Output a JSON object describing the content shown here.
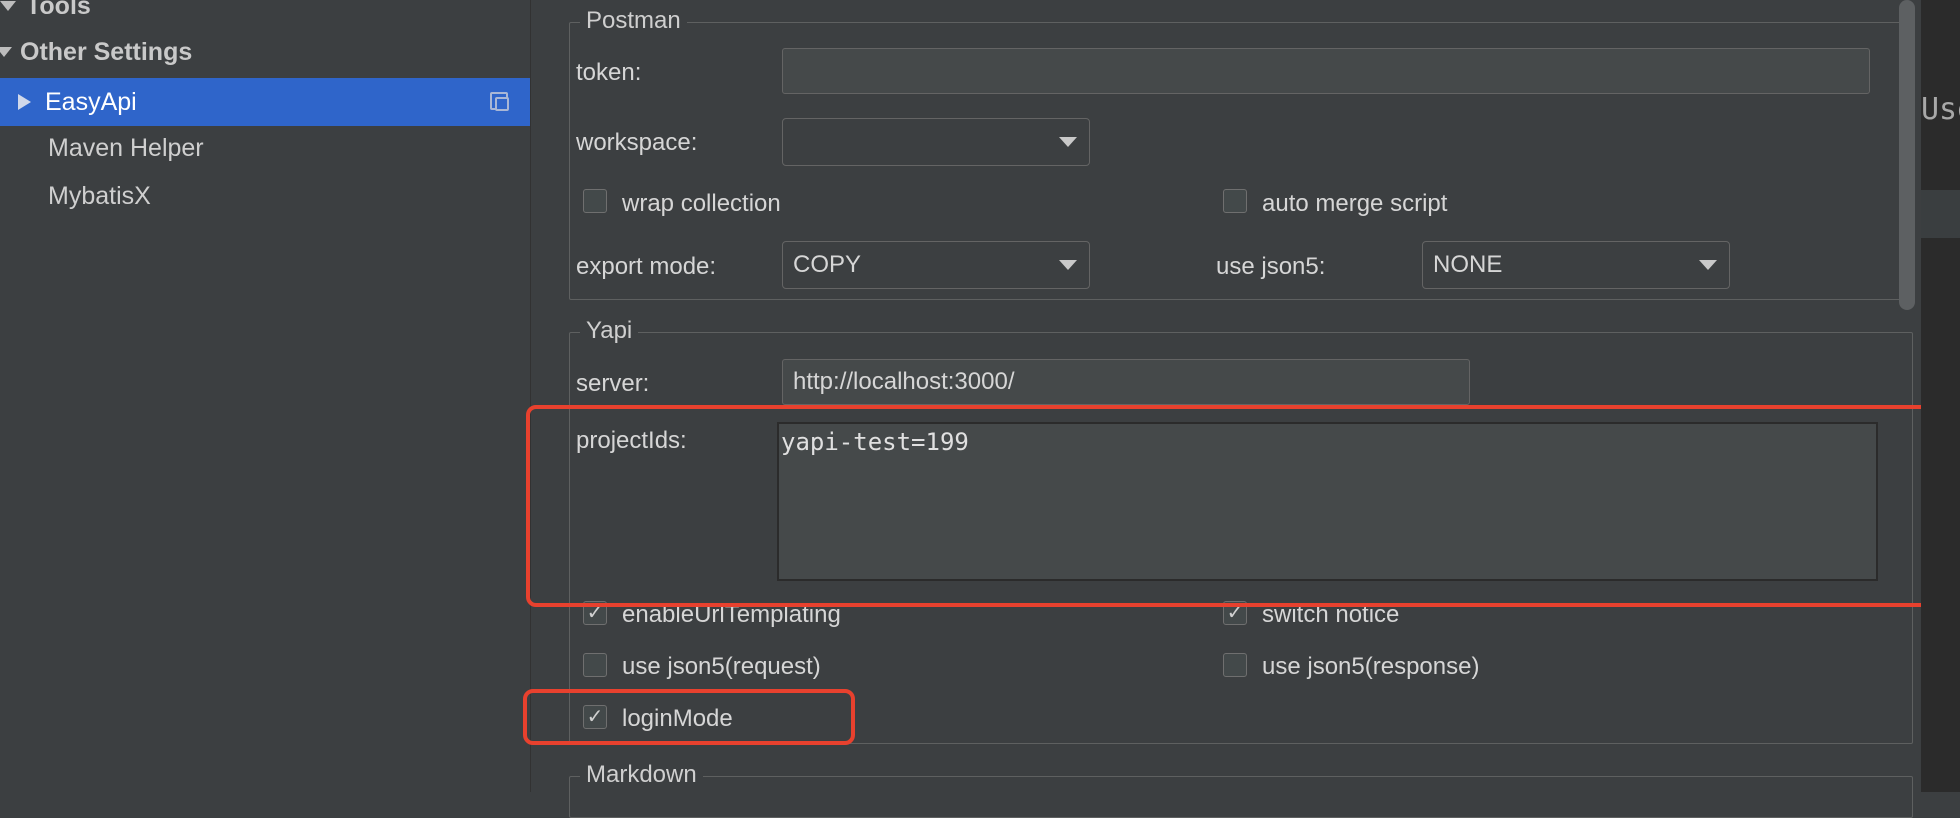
{
  "sidebar": {
    "tools_label": "Tools",
    "other_settings_label": "Other Settings",
    "items": [
      {
        "label": "EasyApi"
      },
      {
        "label": "Maven Helper"
      },
      {
        "label": "MybatisX"
      }
    ]
  },
  "postman": {
    "title": "Postman",
    "token_label": "token:",
    "token_value": "",
    "workspace_label": "workspace:",
    "workspace_value": "",
    "wrap_collection_label": "wrap collection",
    "wrap_collection_checked": false,
    "auto_merge_label": "auto merge script",
    "auto_merge_checked": false,
    "export_mode_label": "export mode:",
    "export_mode_value": "COPY",
    "use_json5_label": "use json5:",
    "use_json5_value": "NONE"
  },
  "yapi": {
    "title": "Yapi",
    "server_label": "server:",
    "server_value": "http://localhost:3000/",
    "project_ids_label": "projectIds:",
    "project_ids_value": "yapi-test=199",
    "enable_url_templating_label": "enableUrlTemplating",
    "enable_url_templating_checked": true,
    "switch_notice_label": "switch notice",
    "switch_notice_checked": true,
    "json5_request_label": "use json5(request)",
    "json5_request_checked": false,
    "json5_response_label": "use json5(response)",
    "json5_response_checked": false,
    "login_mode_label": "loginMode",
    "login_mode_checked": true
  },
  "markdown": {
    "title": "Markdown"
  },
  "checkmark": "✓",
  "right_strip_text": "Use",
  "colors": {
    "selection": "#2f65ca",
    "highlight": "#e8412e",
    "background": "#3c3f41"
  }
}
